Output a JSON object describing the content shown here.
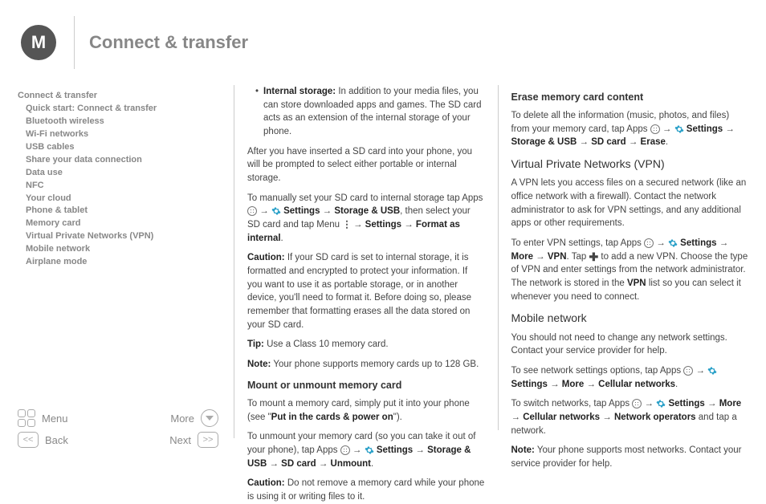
{
  "header": {
    "title": "Connect & transfer"
  },
  "sidebar": {
    "heading": "Connect & transfer",
    "items": [
      "Quick start: Connect & transfer",
      "Bluetooth wireless",
      "Wi-Fi networks",
      "USB cables",
      "Share your data connection",
      "Data use",
      "NFC",
      "Your cloud",
      "Phone & tablet",
      "Memory card",
      "Virtual Private Networks (VPN)",
      "Mobile network",
      "Airplane mode"
    ]
  },
  "nav": {
    "menu": "Menu",
    "more": "More",
    "back": "Back",
    "next": "Next"
  },
  "col1": {
    "bullet_label": "Internal storage:",
    "bullet_text": " In addition to your media files, you can store downloaded apps and games. The SD card acts as an extension of the internal storage of your phone.",
    "p1": "After you have inserted a SD card into your phone, you will be prompted to select either portable or internal storage.",
    "p2a": "To manually set your SD card to internal storage tap Apps ",
    "p2b": " Settings",
    "p2c": "Storage & USB",
    "p2d": ", then select your SD card and tap Menu ",
    "p2e": "Settings",
    "p2f": "Format as internal",
    "caution1_label": "Caution:",
    "caution1_text": " If your SD card is set to internal storage, it is formatted and encrypted to protect your information. If you want to use it as portable storage, or in another device, you'll need to format it. Before doing so, please remember that formatting erases all the data stored on your SD card.",
    "tip_label": "Tip:",
    "tip_text": " Use a Class 10 memory card.",
    "note1_label": "Note:",
    "note1_text": " Your phone supports memory cards up to 128 GB.",
    "h4": "Mount or unmount memory card",
    "mount1a": "To mount a memory card, simply put it into your phone (see \"",
    "mount1b": "Put in the cards & power on",
    "mount1c": "\").",
    "unmount1": "To unmount your memory card (so you can take it out of your phone), tap Apps ",
    "s_settings": "Settings",
    "s_storage": "Storage & USB",
    "s_sdcard": "SD card",
    "s_unmount": "Unmount",
    "caution2_label": "Caution:",
    "caution2_text": " Do not remove a memory card while your phone is using it or writing files to it."
  },
  "col2": {
    "h4_erase": "Erase memory card content",
    "erase_p1": "To delete all the information (music, photos, and files) from your memory card, tap Apps ",
    "s_settings": "Settings",
    "s_storage": "Storage & USB",
    "s_sdcard": "SD card",
    "s_erase": "Erase",
    "h3_vpn": "Virtual Private Networks (VPN)",
    "vpn_p1": "A VPN lets you access files on a secured network (like an office network with a firewall). Contact the network administrator to ask for VPN settings, and any additional apps or other requirements.",
    "vpn_p2a": "To enter VPN settings, tap Apps ",
    "s_more": "More",
    "s_vpn": "VPN",
    "vpn_p2b": ". Tap ",
    "vpn_p2c": " to add a new VPN. Choose the type of VPN and enter settings from the network administrator. The network is stored in the ",
    "vpn_bold": "VPN",
    "vpn_p2d": " list so you can select it whenever you need to connect.",
    "h3_mobile": "Mobile network",
    "mob_p1": "You should not need to change any network settings. Contact your service provider for help.",
    "mob_p2": "To see network settings options, tap Apps ",
    "s_cell": "Cellular networks",
    "mob_p3": "To switch networks, tap Apps ",
    "s_netop": "Network operators",
    "mob_p3b": " and tap a network.",
    "note_label": "Note:",
    "note_text": " Your phone supports most networks. Contact your service provider for help."
  }
}
